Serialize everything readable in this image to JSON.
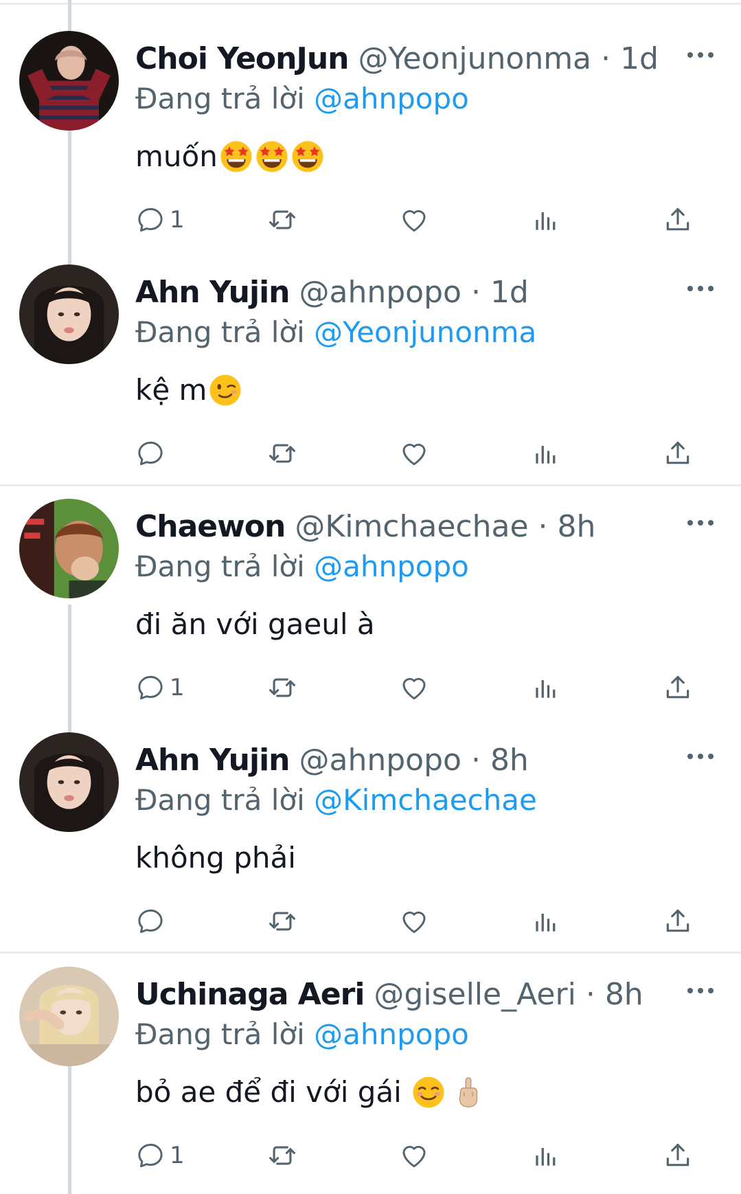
{
  "tweets": [
    {
      "name": "Choi YeonJun",
      "handle": "@Yeonjunonma",
      "dot": "·",
      "time": "1d",
      "reply_prefix": "Đang trả lời",
      "reply_to": "@ahnpopo",
      "text": "muốn",
      "emojis": [
        "star-struck-face",
        "star-struck-face",
        "star-struck-face"
      ],
      "reply_count": "1",
      "avatar": "red-striped-sweater"
    },
    {
      "name": "Ahn Yujin",
      "handle": "@ahnpopo",
      "dot": "·",
      "time": "1d",
      "reply_prefix": "Đang trả lời",
      "reply_to": "@Yeonjunonma",
      "text": "kệ m",
      "emojis": [
        "winking-face"
      ],
      "reply_count": "",
      "avatar": "dark-hair-girl"
    },
    {
      "name": "Chaewon",
      "handle": "@Kimchaechae",
      "dot": "·",
      "time": "8h",
      "reply_prefix": "Đang trả lời",
      "reply_to": "@ahnpopo",
      "text": "đi ăn với gaeul à",
      "emojis": [],
      "reply_count": "1",
      "avatar": "green-fur-girl"
    },
    {
      "name": "Ahn Yujin",
      "handle": "@ahnpopo",
      "dot": "·",
      "time": "8h",
      "reply_prefix": "Đang trả lời",
      "reply_to": "@Kimchaechae",
      "text": "không phải",
      "emojis": [],
      "reply_count": "",
      "avatar": "dark-hair-girl"
    },
    {
      "name": "Uchinaga Aeri",
      "handle": "@giselle_Aeri",
      "dot": "·",
      "time": "8h",
      "reply_prefix": "Đang trả lời",
      "reply_to": "@ahnpopo",
      "text": "bỏ ae để đi với gái",
      "emojis": [
        "smiling-face",
        "middle-finger"
      ],
      "reply_count": "1",
      "avatar": "blonde-girl"
    }
  ],
  "icons": {
    "reply": "reply-icon",
    "retweet": "retweet-icon",
    "like": "heart-icon",
    "views": "views-icon",
    "share": "share-icon",
    "more": "more-icon"
  },
  "colors": {
    "link": "#1d9bf0",
    "secondary_text": "#53646e",
    "primary_text": "#141823",
    "divider": "#e6ecf0",
    "thread_line": "#cfd9de"
  }
}
